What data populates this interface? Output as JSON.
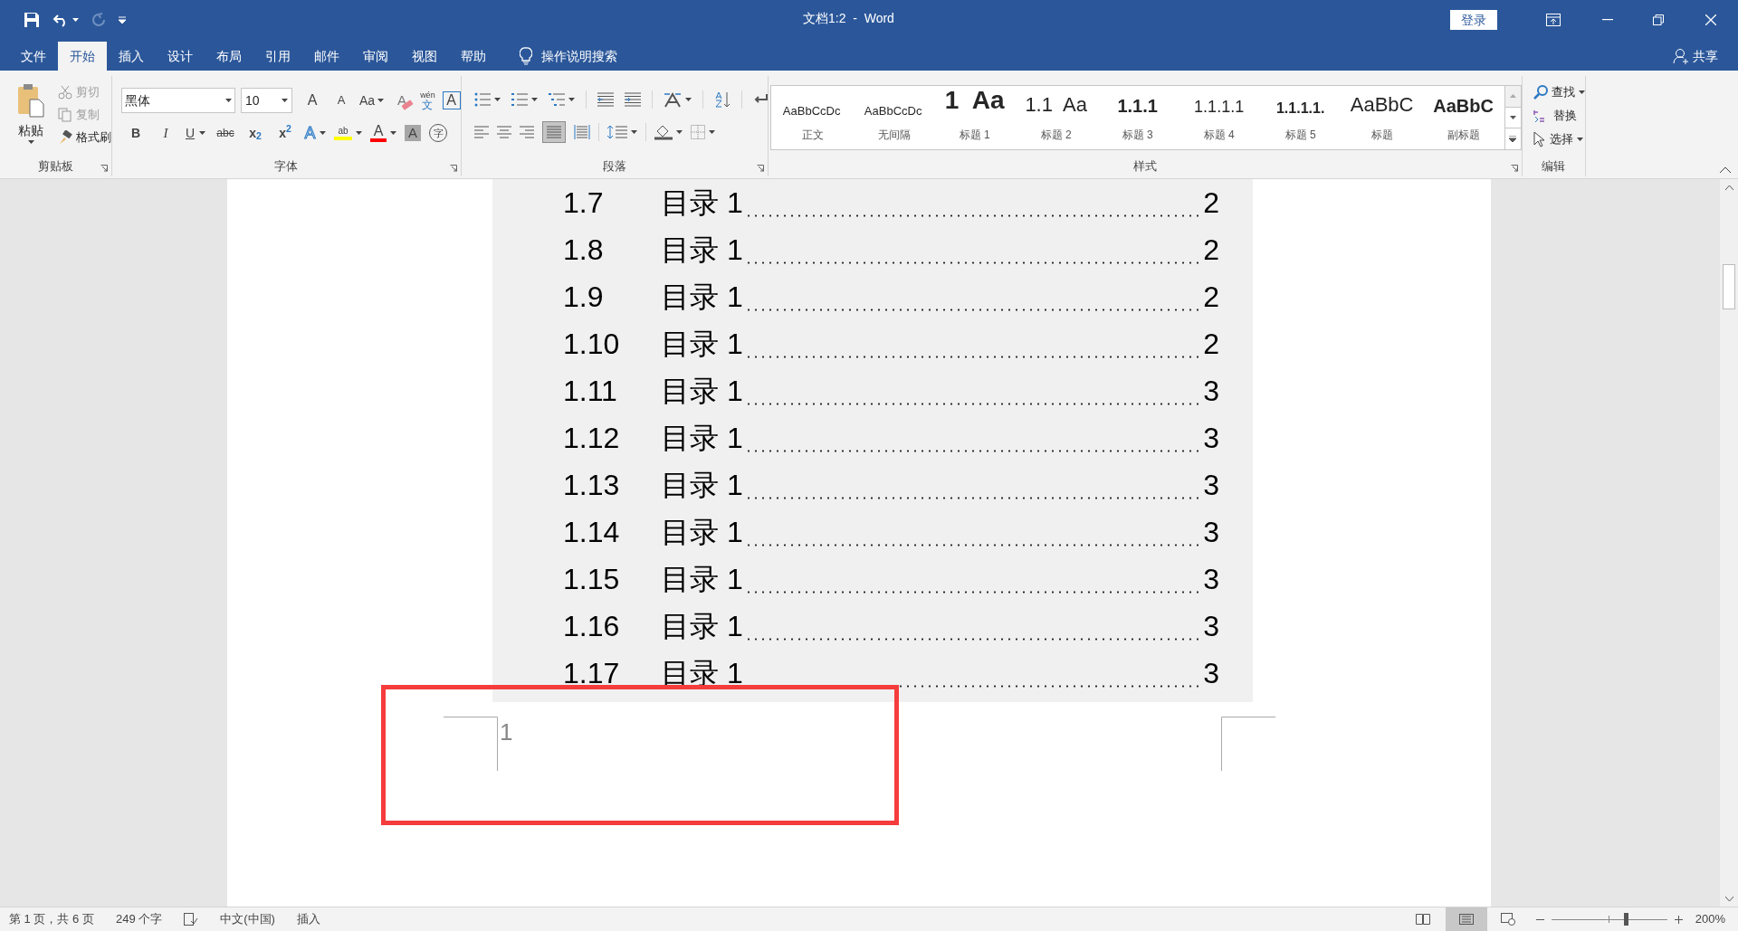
{
  "window": {
    "title": "文档1:2  -  Word",
    "sign_in": "登录"
  },
  "tabs": [
    {
      "label": "文件",
      "selected": false
    },
    {
      "label": "开始",
      "selected": true
    },
    {
      "label": "插入",
      "selected": false
    },
    {
      "label": "设计",
      "selected": false
    },
    {
      "label": "布局",
      "selected": false
    },
    {
      "label": "引用",
      "selected": false
    },
    {
      "label": "邮件",
      "selected": false
    },
    {
      "label": "审阅",
      "selected": false
    },
    {
      "label": "视图",
      "selected": false
    },
    {
      "label": "帮助",
      "selected": false
    }
  ],
  "tell_me": "操作说明搜索",
  "share": "共享",
  "clipboard": {
    "paste": "粘贴",
    "items": [
      {
        "label": "剪切",
        "kind": "cut",
        "disabled": true
      },
      {
        "label": "复制",
        "kind": "copy",
        "disabled": true
      },
      {
        "label": "格式刷",
        "kind": "painter",
        "disabled": false
      }
    ],
    "group": "剪贴板"
  },
  "font": {
    "name": "黑体",
    "size": "10",
    "row1": [
      {
        "text": "A",
        "kind": "grow"
      },
      {
        "text": "A",
        "kind": "shrink"
      },
      {
        "text": "Aa",
        "kind": "case"
      },
      {
        "text": "A",
        "kind": "clear"
      },
      {
        "text": "wén",
        "kind": "phonetic-top"
      },
      {
        "text": "文",
        "kind": "phonetic"
      },
      {
        "text": "A",
        "kind": "boxed"
      }
    ],
    "row2": [
      {
        "text": "B",
        "kind": "bold"
      },
      {
        "text": "I",
        "kind": "italic"
      },
      {
        "text": "U",
        "kind": "underline"
      },
      {
        "text": "abc",
        "kind": "strike"
      },
      {
        "text": "x$_{2}$",
        "kind": "sub"
      },
      {
        "text": "x$^{2}$",
        "kind": "sup"
      },
      {
        "text": "A",
        "kind": "effect"
      },
      {
        "text": "ab",
        "kind": "highlight"
      },
      {
        "text": "A",
        "kind": "color"
      },
      {
        "text": "A",
        "kind": "shading"
      },
      {
        "text": "字",
        "kind": "enclose"
      }
    ],
    "group": "字体"
  },
  "paragraph": {
    "group": "段落"
  },
  "styles": {
    "items": [
      {
        "preview": "AaBbCcDc",
        "label": "正文",
        "kind": "body"
      },
      {
        "preview": "AaBbCcDc",
        "label": "无间隔",
        "kind": "body"
      },
      {
        "preview": "1  Aa",
        "label": "标题 1",
        "kind": "heading-1"
      },
      {
        "preview": "1.1  Aa",
        "label": "标题 2",
        "kind": "heading-2"
      },
      {
        "preview": "1.1.1",
        "label": "标题 3",
        "kind": "heading-3"
      },
      {
        "preview": "1.1.1.1",
        "label": "标题 4",
        "kind": "heading-4"
      },
      {
        "preview": "1.1.1.1.",
        "label": "标题 5",
        "kind": "heading-5"
      },
      {
        "preview": "AaBbC",
        "label": "标题",
        "kind": "title"
      },
      {
        "preview": "AaBbC",
        "label": "副标题",
        "kind": "subtitle"
      }
    ],
    "group": "样式"
  },
  "editing": {
    "items": [
      {
        "label": "查找",
        "kind": "find"
      },
      {
        "label": "替换",
        "kind": "replace"
      },
      {
        "label": "选择",
        "kind": "select"
      }
    ],
    "group": "编辑"
  },
  "document": {
    "toc": [
      {
        "number": "1.7",
        "text": "目录 1",
        "page": "2"
      },
      {
        "number": "1.8",
        "text": "目录 1",
        "page": "2"
      },
      {
        "number": "1.9",
        "text": "目录 1",
        "page": "2"
      },
      {
        "number": "1.10",
        "text": "目录 1",
        "page": "2"
      },
      {
        "number": "1.11",
        "text": "目录 1",
        "page": "3"
      },
      {
        "number": "1.12",
        "text": "目录 1",
        "page": "3"
      },
      {
        "number": "1.13",
        "text": "目录 1",
        "page": "3"
      },
      {
        "number": "1.14",
        "text": "目录 1",
        "page": "3"
      },
      {
        "number": "1.15",
        "text": "目录 1",
        "page": "3"
      },
      {
        "number": "1.16",
        "text": "目录 1",
        "page": "3"
      },
      {
        "number": "1.17",
        "text": "目录 1",
        "page": "3"
      }
    ],
    "footer_page_number": "1"
  },
  "status_bar": {
    "page": "第 1 页，共 6 页",
    "words": "249 个字",
    "language": "中文(中国)",
    "mode": "插入",
    "zoom": "200%",
    "zoom_level": {
      "level": 0.64
    }
  }
}
